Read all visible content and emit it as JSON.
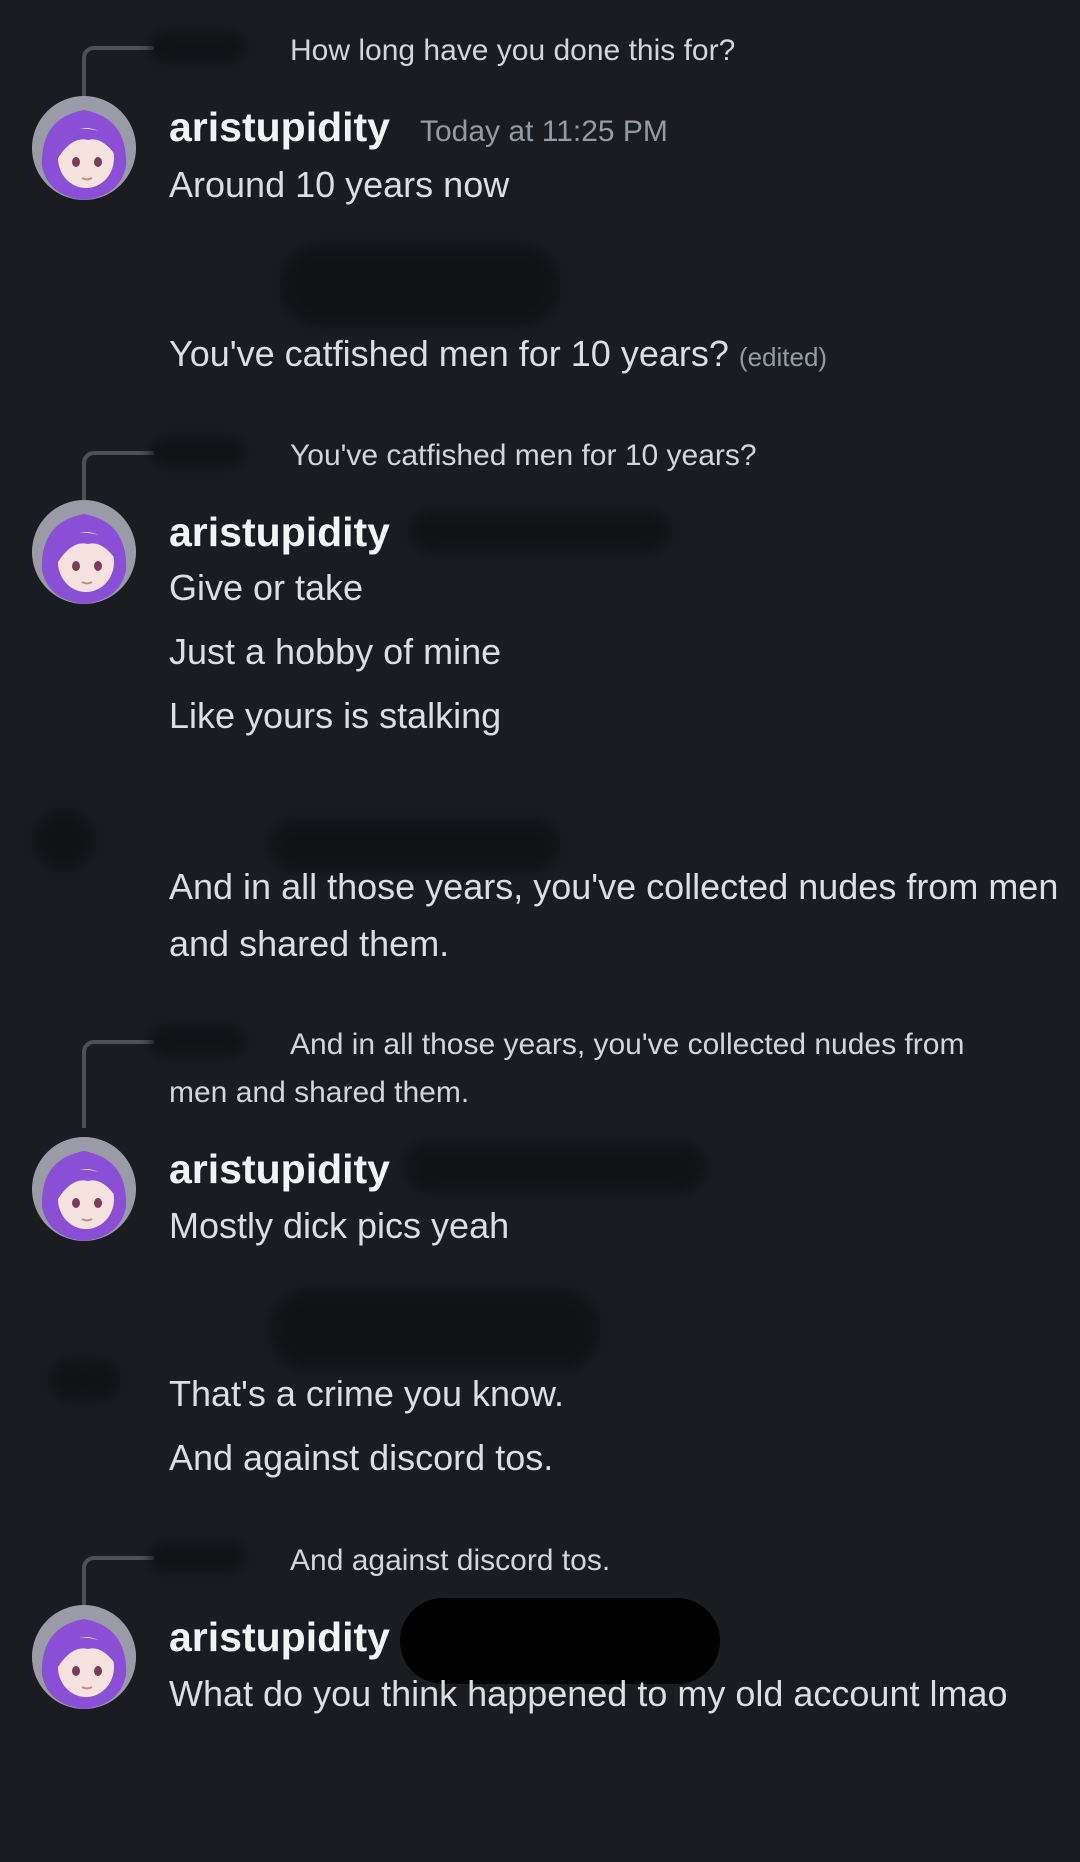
{
  "messages": [
    {
      "reply_to": "How long have you done this for?",
      "username": "aristupidity",
      "timestamp": "Today at 11:25 PM",
      "lines": [
        "Around 10 years now"
      ]
    },
    {
      "text": "You've catfished men for 10 years?",
      "edited_label": "(edited)"
    },
    {
      "reply_to": "You've catfished men for 10 years?",
      "username": "aristupidity",
      "lines": [
        "Give or take",
        "Just a hobby of mine",
        "Like yours is stalking"
      ]
    },
    {
      "text": "And in all those years, you've collected nudes from men and shared them."
    },
    {
      "reply_to_line1": "And in all those years, you've collected nudes from",
      "reply_to_line2": "men and shared them.",
      "username": "aristupidity",
      "lines": [
        "Mostly dick pics yeah"
      ]
    },
    {
      "lines": [
        "That's a crime you know.",
        "And against discord tos."
      ]
    },
    {
      "reply_to": "And against discord tos.",
      "username": "aristupidity",
      "text": "What do you think happened to my old account lmao"
    }
  ],
  "colors": {
    "background": "#1b1c21",
    "username": "#f2f3f5",
    "message": "#dcdee1",
    "muted": "#949ba4",
    "reply_spine": "#4e5058",
    "avatar_hair": "#8b4fd6"
  }
}
